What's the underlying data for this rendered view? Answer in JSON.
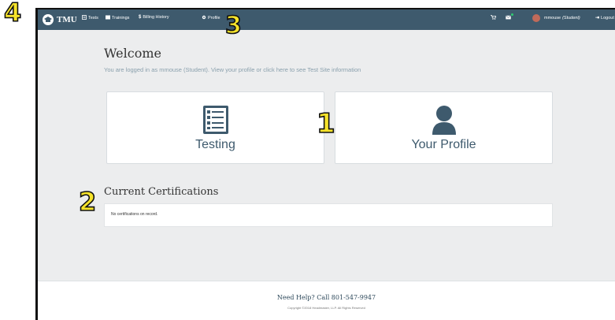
{
  "navbar": {
    "brand": "TMU",
    "items": [
      {
        "label": "Tests",
        "icon": "list-icon"
      },
      {
        "label": "Trainings",
        "icon": "book-icon"
      },
      {
        "label": "Billing History",
        "icon": "dollar-icon"
      },
      {
        "label": "Profile",
        "icon": "gear-icon"
      }
    ],
    "user": {
      "name": "mmouse",
      "role": "(Student)"
    },
    "logout": "Logout"
  },
  "main": {
    "title": "Welcome",
    "subtitle": "You are logged in as mmouse (Student). View your profile or click here to see Test Site information",
    "cards": [
      {
        "label": "Testing",
        "icon": "checklist-icon"
      },
      {
        "label": "Your Profile",
        "icon": "user-icon"
      }
    ],
    "certifications": {
      "title": "Current Certifications",
      "empty_text": "No certifications on record."
    }
  },
  "footer": {
    "help": "Need Help? Call 801-547-9947",
    "copyright": "Copyright ©2018 Headmaster, LLP. All Rights Reserved"
  },
  "annotations": [
    "1",
    "2",
    "3",
    "4"
  ],
  "colors": {
    "navbar": "#3e5a6d",
    "accent": "#3e5a6d",
    "callout": "#f6e32a",
    "background": "#ecedee"
  }
}
